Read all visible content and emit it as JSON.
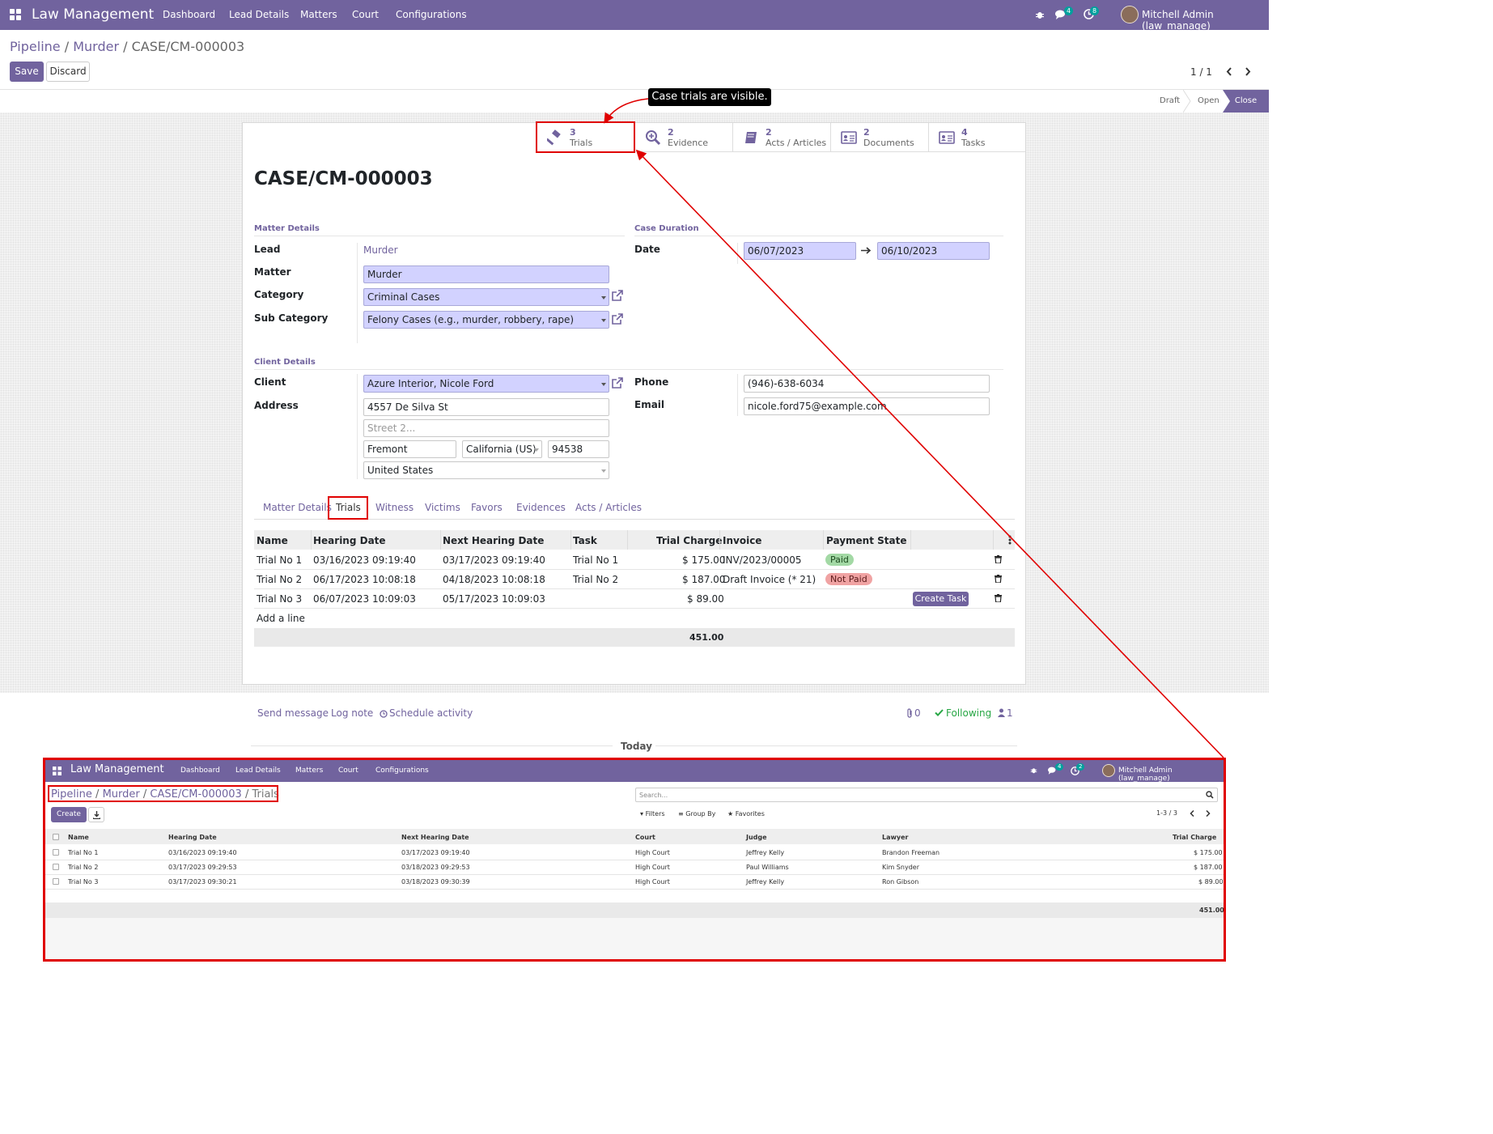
{
  "app": {
    "brand": "Law Management",
    "menu": [
      "Dashboard",
      "Lead Details",
      "Matters",
      "Court",
      "Configurations"
    ],
    "messages_count": "4",
    "activities_count": "8",
    "user": "Mitchell Admin (law_manage)"
  },
  "breadcrumb": {
    "pipeline": "Pipeline",
    "murder": "Murder",
    "sep": "/",
    "current": "CASE/CM-000003"
  },
  "buttons": {
    "save": "Save",
    "discard": "Discard"
  },
  "pager": "1 / 1",
  "status": {
    "draft": "Draft",
    "open": "Open",
    "close": "Close"
  },
  "callout": "Case trials are visible.",
  "smart_buttons": [
    {
      "count": "3",
      "label": "Trials",
      "icon": "gavel-icon"
    },
    {
      "count": "2",
      "label": "Evidence",
      "icon": "magnifier-plus-icon"
    },
    {
      "count": "2",
      "label": "Acts / Articles",
      "icon": "book-icon"
    },
    {
      "count": "2",
      "label": "Documents",
      "icon": "id-card-icon"
    },
    {
      "count": "4",
      "label": "Tasks",
      "icon": "id-card-icon"
    }
  ],
  "record_title": "CASE/CM-000003",
  "matter_details": {
    "group": "Matter Details",
    "lead_label": "Lead",
    "lead": "Murder",
    "matter_label": "Matter",
    "matter": "Murder",
    "category_label": "Category",
    "category": "Criminal Cases",
    "subcategory_label": "Sub Category",
    "subcategory": "Felony Cases (e.g., murder, robbery, rape)"
  },
  "case_duration": {
    "group": "Case Duration",
    "date_label": "Date",
    "start": "06/07/2023",
    "end": "06/10/2023"
  },
  "client_details": {
    "group": "Client Details",
    "client_label": "Client",
    "client": "Azure Interior, Nicole Ford",
    "address_label": "Address",
    "street": "4557 De Silva St",
    "street2_placeholder": "Street 2...",
    "city": "Fremont",
    "state": "California (US)",
    "zip": "94538",
    "country": "United States",
    "phone_label": "Phone",
    "phone": "(946)-638-6034",
    "email_label": "Email",
    "email": "nicole.ford75@example.com"
  },
  "tabs": [
    "Matter Details",
    "Trials",
    "Witness",
    "Victims",
    "Favors",
    "Evidences",
    "Acts / Articles"
  ],
  "trials_table": {
    "headers": [
      "Name",
      "Hearing Date",
      "Next Hearing Date",
      "Task",
      "Trial Charge",
      "Invoice",
      "Payment State"
    ],
    "rows": [
      {
        "name": "Trial No 1",
        "hearing": "03/16/2023 09:19:40",
        "next": "03/17/2023 09:19:40",
        "task": "Trial No 1",
        "charge": "$ 175.00",
        "invoice": "INV/2023/00005",
        "state": "Paid"
      },
      {
        "name": "Trial No 2",
        "hearing": "06/17/2023 10:08:18",
        "next": "04/18/2023 10:08:18",
        "task": "Trial No 2",
        "charge": "$ 187.00",
        "invoice": "Draft Invoice (* 21)",
        "state": "Not Paid"
      },
      {
        "name": "Trial No 3",
        "hearing": "06/07/2023 10:09:03",
        "next": "05/17/2023 10:09:03",
        "task": "",
        "charge": "$ 89.00",
        "invoice": "",
        "state": ""
      }
    ],
    "create_task": "Create Task",
    "add_line": "Add a line",
    "total": "451.00"
  },
  "chatter": {
    "send": "Send message",
    "log": "Log note",
    "schedule": "Schedule activity",
    "attachments": "0",
    "following": "Following",
    "followers": "1",
    "today": "Today"
  },
  "inset": {
    "brand": "Law Management",
    "menu": [
      "Dashboard",
      "Lead Details",
      "Matters",
      "Court",
      "Configurations"
    ],
    "messages_count": "4",
    "activities_count": "2",
    "user": "Mitchell Admin (law_manage)",
    "breadcrumb": {
      "pipeline": "Pipeline",
      "murder": "Murder",
      "case": "CASE/CM-000003",
      "current": "Trials",
      "sep": "/"
    },
    "search_placeholder": "Search...",
    "filters": "Filters",
    "group_by": "Group By",
    "favorites": "Favorites",
    "create": "Create",
    "pager": "1-3 / 3",
    "headers": [
      "Name",
      "Hearing Date",
      "Next Hearing Date",
      "Court",
      "Judge",
      "Lawyer",
      "Trial Charge"
    ],
    "rows": [
      {
        "name": "Trial No 1",
        "hearing": "03/16/2023 09:19:40",
        "next": "03/17/2023 09:19:40",
        "court": "High Court",
        "judge": "Jeffrey Kelly",
        "lawyer": "Brandon Freeman",
        "charge": "$ 175.00"
      },
      {
        "name": "Trial No 2",
        "hearing": "03/17/2023 09:29:53",
        "next": "03/18/2023 09:29:53",
        "court": "High Court",
        "judge": "Paul Williams",
        "lawyer": "Kim Snyder",
        "charge": "$ 187.00"
      },
      {
        "name": "Trial No 3",
        "hearing": "03/17/2023 09:30:21",
        "next": "03/18/2023 09:30:39",
        "court": "High Court",
        "judge": "Jeffrey Kelly",
        "lawyer": "Ron Gibson",
        "charge": "$ 89.00"
      }
    ],
    "total": "451.00"
  },
  "colors": {
    "brand": "#71639e",
    "required_field": "#d2d2ff",
    "paid": "#a3d9a5",
    "not_paid": "#f0a3a3",
    "annotation": "#e00000"
  }
}
